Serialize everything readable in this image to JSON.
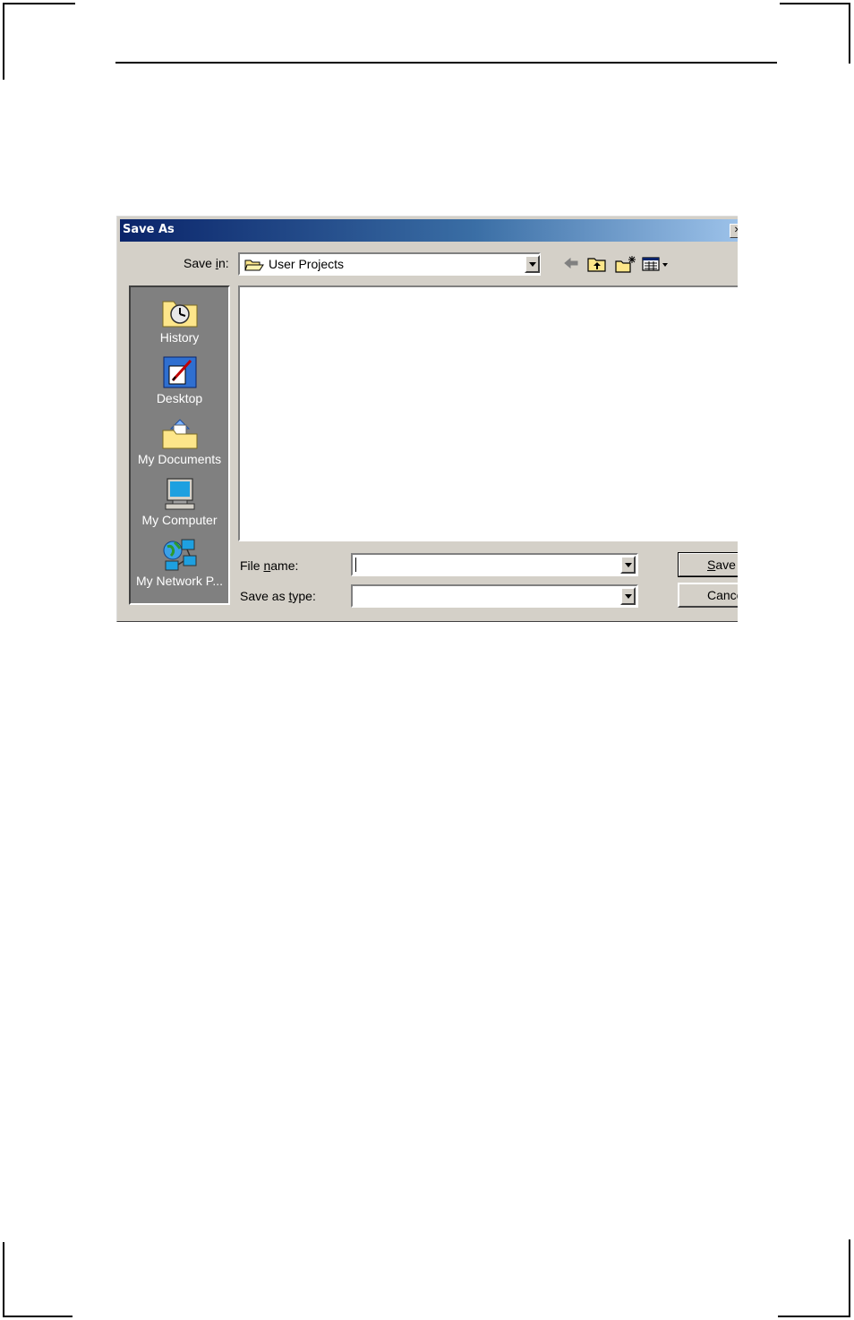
{
  "dialog": {
    "title": "Save As",
    "save_in_label_pre": "Save ",
    "save_in_label_key": "i",
    "save_in_label_post": "n:",
    "save_in_value": "User Projects",
    "places": [
      {
        "label": "History",
        "icon": "history-icon"
      },
      {
        "label": "Desktop",
        "icon": "desktop-icon"
      },
      {
        "label": "My Documents",
        "icon": "my-documents-icon"
      },
      {
        "label": "My Computer",
        "icon": "my-computer-icon"
      },
      {
        "label": "My Network P...",
        "icon": "my-network-icon"
      }
    ],
    "file_name_label_pre": "File ",
    "file_name_label_key": "n",
    "file_name_label_post": "ame:",
    "file_name_value": "",
    "save_as_type_label_pre": "Save as ",
    "save_as_type_label_key": "t",
    "save_as_type_label_post": "ype:",
    "save_as_type_value": "",
    "save_button_key": "S",
    "save_button_rest": "ave",
    "cancel_button": "Cance"
  },
  "colors": {
    "titlebar_start": "#0a246a",
    "titlebar_end": "#a6caf0",
    "dialog_face": "#d4d0c8",
    "places_bar": "#808080"
  }
}
